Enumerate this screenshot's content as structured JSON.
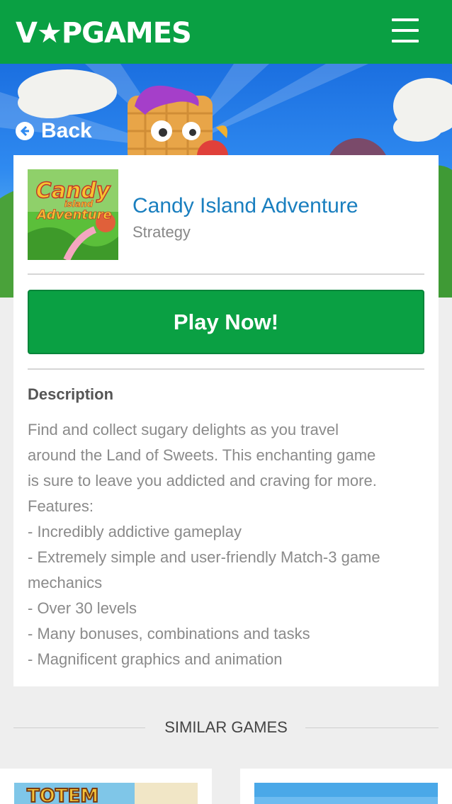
{
  "header": {
    "logo_text": "V★PGAMES",
    "menu_icon": "hamburger-icon"
  },
  "nav": {
    "back_label": "Back",
    "back_icon": "arrow-left-circle-icon"
  },
  "game": {
    "title": "Candy Island Adventure",
    "category": "Strategy",
    "thumbnail_text": [
      "Candy",
      "island",
      "Adventure"
    ],
    "play_label": "Play Now!"
  },
  "description": {
    "heading": "Description",
    "lines": [
      "Find and collect sugary delights as you travel",
      "around the Land of Sweets. This enchanting game",
      "is sure to leave you addicted and craving for more.",
      "Features:",
      "- Incredibly addictive gameplay",
      "- Extremely simple and user-friendly Match-3 game",
      "mechanics",
      "- Over 30 levels",
      "- Many bonuses, combinations and tasks",
      "- Magnificent graphics and animation"
    ]
  },
  "similar": {
    "heading": "SIMILAR GAMES",
    "tiles": [
      {
        "thumb_text": "TOTEM"
      },
      {
        "thumb_text": ""
      }
    ]
  },
  "colors": {
    "brand_green": "#0aa043",
    "link_blue": "#1a7fbf",
    "text_gray": "#8a8a8a"
  }
}
